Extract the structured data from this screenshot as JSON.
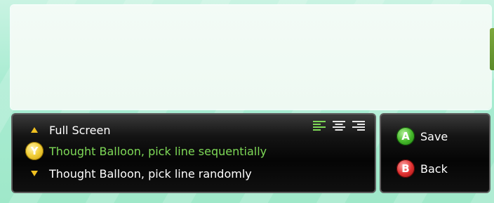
{
  "options": [
    {
      "label": "Full Screen",
      "marker": "up-arrow-icon",
      "selected": false
    },
    {
      "label": "Thought Balloon, pick line sequentially",
      "marker": "y-button-icon",
      "marker_text": "Y",
      "selected": true
    },
    {
      "label": "Thought Balloon, pick line randomly",
      "marker": "down-arrow-icon",
      "selected": false
    }
  ],
  "alignment": {
    "options": [
      "align-left-icon",
      "align-center-icon",
      "align-right-icon"
    ],
    "selected": "align-left-icon",
    "active_color": "#7ed957",
    "inactive_color": "#e8e8e8"
  },
  "actions": {
    "save": {
      "badge": "A",
      "label": "Save",
      "color": "#45b82a"
    },
    "back": {
      "badge": "B",
      "label": "Back",
      "color": "#e03030"
    }
  },
  "colors": {
    "selected_text": "#7ed957",
    "normal_text": "#ffffff",
    "arrow": "#f0c020"
  }
}
